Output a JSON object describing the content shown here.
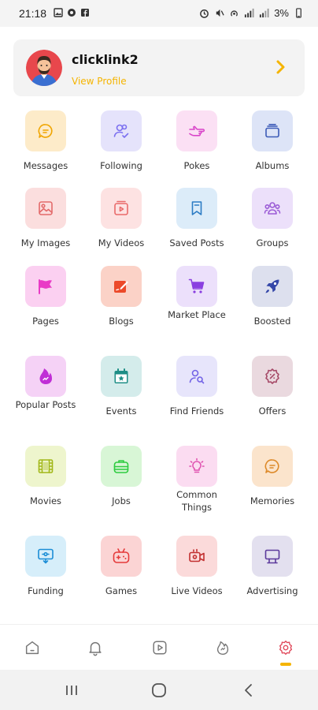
{
  "status": {
    "time": "21:18",
    "battery": "3%"
  },
  "profile": {
    "name": "clicklink2",
    "link_label": "View Profile"
  },
  "tiles": [
    {
      "label": "Messages",
      "icon": "message-icon",
      "bg": "#fdebc9",
      "fg": "#f0a500"
    },
    {
      "label": "Following",
      "icon": "user-check-icon",
      "bg": "#e5e3fb",
      "fg": "#7b6ff0"
    },
    {
      "label": "Pokes",
      "icon": "pointing-hand-icon",
      "bg": "#fbe0f4",
      "fg": "#d946c9"
    },
    {
      "label": "Albums",
      "icon": "album-icon",
      "bg": "#dde4f7",
      "fg": "#3d5bb8"
    },
    {
      "label": "My Images",
      "icon": "image-icon",
      "bg": "#fbdede",
      "fg": "#e36a6a"
    },
    {
      "label": "My Videos",
      "icon": "video-icon",
      "bg": "#fde2e2",
      "fg": "#e96a6a"
    },
    {
      "label": "Saved Posts",
      "icon": "bookmark-icon",
      "bg": "#dcecf9",
      "fg": "#2c7cc4"
    },
    {
      "label": "Groups",
      "icon": "groups-icon",
      "bg": "#ece0fa",
      "fg": "#9b5bd6"
    },
    {
      "label": "Pages",
      "icon": "flag-icon",
      "bg": "#fbd0f1",
      "fg": "#e93bc6"
    },
    {
      "label": "Blogs",
      "icon": "blog-icon",
      "bg": "#fbd2c7",
      "fg": "#ec4a2a"
    },
    {
      "label": "Market Place",
      "icon": "cart-icon",
      "bg": "#ece0fb",
      "fg": "#8a3fe0"
    },
    {
      "label": "Boosted",
      "icon": "rocket-icon",
      "bg": "#dde0ee",
      "fg": "#3446a8"
    },
    {
      "label": "Popular Posts",
      "icon": "fire-icon",
      "bg": "#f5d2f6",
      "fg": "#c02fd6"
    },
    {
      "label": "Events",
      "icon": "calendar-star-icon",
      "bg": "#d4eceb",
      "fg": "#1e8e86"
    },
    {
      "label": "Find Friends",
      "icon": "user-search-icon",
      "bg": "#e7e5fb",
      "fg": "#7263e6"
    },
    {
      "label": "Offers",
      "icon": "discount-icon",
      "bg": "#ead9df",
      "fg": "#a64a68"
    },
    {
      "label": "Movies",
      "icon": "film-icon",
      "bg": "#eef5cd",
      "fg": "#a2b81a"
    },
    {
      "label": "Jobs",
      "icon": "briefcase-icon",
      "bg": "#d8f6d6",
      "fg": "#2ecc40"
    },
    {
      "label": "Common Things",
      "icon": "lightbulb-icon",
      "bg": "#fbdcf1",
      "fg": "#e052b0"
    },
    {
      "label": "Memories",
      "icon": "memory-chat-icon",
      "bg": "#fbe4cc",
      "fg": "#dd8a2a"
    },
    {
      "label": "Funding",
      "icon": "funding-icon",
      "bg": "#d6eefa",
      "fg": "#1c8ed6"
    },
    {
      "label": "Games",
      "icon": "gamepad-icon",
      "bg": "#fbd4d4",
      "fg": "#e53a3a"
    },
    {
      "label": "Live Videos",
      "icon": "live-video-icon",
      "bg": "#fbdada",
      "fg": "#c23030"
    },
    {
      "label": "Advertising",
      "icon": "billboard-icon",
      "bg": "#e3e0ef",
      "fg": "#5c3a9c"
    }
  ],
  "nav": {
    "items": [
      "home-icon",
      "bell-icon",
      "video-play-icon",
      "trending-icon",
      "settings-icon"
    ],
    "active": "settings-icon",
    "accent": "#f5b400",
    "active_color": "#e0485a"
  }
}
